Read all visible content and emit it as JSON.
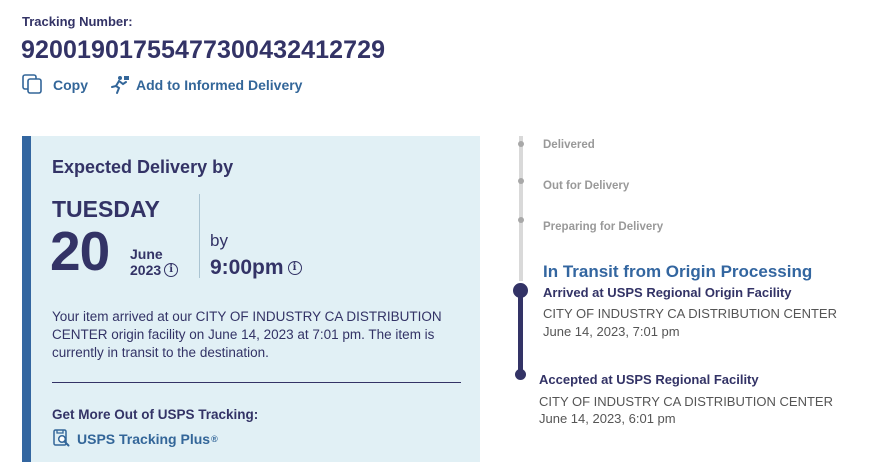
{
  "tracking": {
    "label": "Tracking Number:",
    "number": "9200190175547730043241272​9"
  },
  "actions": {
    "copy_label": "Copy",
    "informed_label": "Add to Informed Delivery"
  },
  "expected": {
    "title": "Expected Delivery by",
    "day": "TUESDAY",
    "date": "20",
    "month": "June",
    "year": "2023",
    "by": "by",
    "time": "9:00pm",
    "info_icon": "i",
    "description": "Your item arrived at our CITY OF INDUSTRY CA DISTRIBUTION CENTER origin facility on June 14, 2023 at 7:01 pm. The item is currently in transit to the destination.",
    "more_title": "Get More Out of USPS Tracking:",
    "plus_label": "USPS Tracking Plus",
    "plus_mark": "®"
  },
  "timeline": {
    "upcoming": [
      {
        "label": "Delivered"
      },
      {
        "label": "Out for Delivery"
      },
      {
        "label": "Preparing for Delivery"
      }
    ],
    "current_status": "In Transit from Origin Processing",
    "events": [
      {
        "title": "Arrived at USPS Regional Origin Facility",
        "location": "CITY OF INDUSTRY CA DISTRIBUTION CENTER",
        "time": "June 14, 2023, 7:01 pm"
      },
      {
        "title": "Accepted at USPS Regional Facility",
        "location": "CITY OF INDUSTRY CA DISTRIBUTION CENTER",
        "time": "June 14, 2023, 6:01 pm"
      }
    ]
  },
  "colors": {
    "navy": "#333366",
    "link_blue": "#336699",
    "card_bg": "#e1f0f5",
    "card_border": "#3366a0"
  },
  "icons": {
    "copy": "copy-icon",
    "informed": "runner-icon",
    "plus": "tracking-plus-icon",
    "info": "info-icon"
  }
}
